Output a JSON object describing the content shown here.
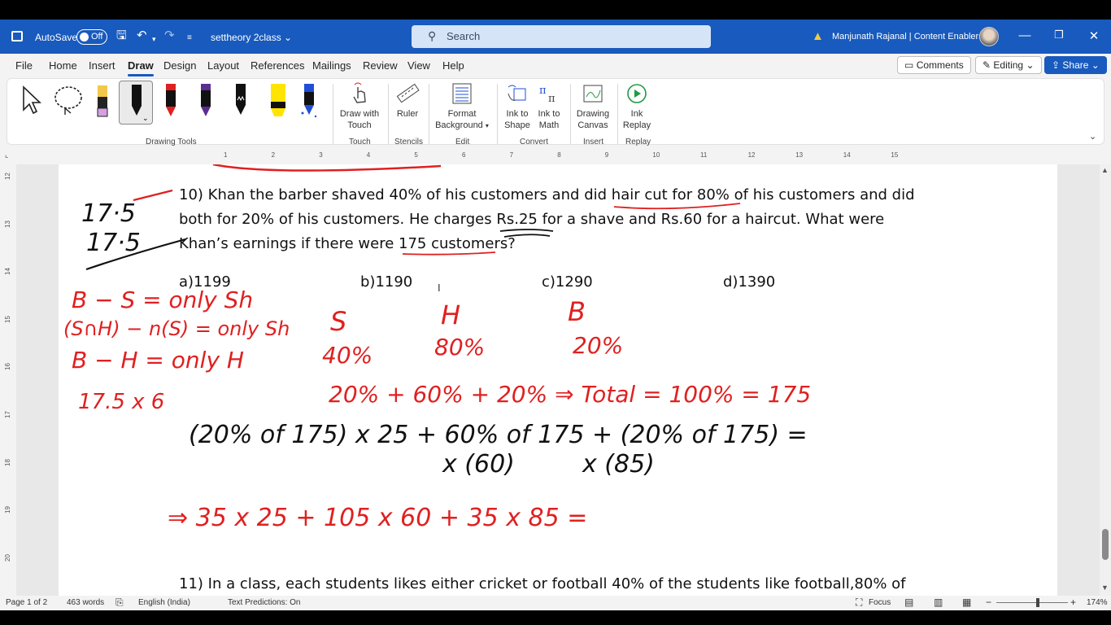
{
  "titlebar": {
    "autosave_label": "AutoSave",
    "autosave_state": "Off",
    "doc_name": "settheory 2class",
    "search_placeholder": "Search",
    "user_name": "Manjunath Rajanal | Content Enablers"
  },
  "menu": {
    "tabs": [
      "File",
      "Home",
      "Insert",
      "Draw",
      "Design",
      "Layout",
      "References",
      "Mailings",
      "Review",
      "View",
      "Help"
    ],
    "active_tab": "Draw",
    "comments_label": "Comments",
    "editing_label": "Editing",
    "share_label": "Share"
  },
  "ribbon": {
    "groups": {
      "drawing_tools": "Drawing Tools",
      "touch": "Touch",
      "stencils": "Stencils",
      "edit": "Edit",
      "convert": "Convert",
      "insert": "Insert",
      "replay": "Replay"
    },
    "draw_with_touch_1": "Draw with",
    "draw_with_touch_2": "Touch",
    "ruler": "Ruler",
    "format_background_1": "Format",
    "format_background_2": "Background",
    "ink_to_shape_1": "Ink to",
    "ink_to_shape_2": "Shape",
    "ink_to_math_1": "Ink to",
    "ink_to_math_2": "Math",
    "drawing_canvas_1": "Drawing",
    "drawing_canvas_2": "Canvas",
    "ink_replay_1": "Ink",
    "ink_replay_2": "Replay",
    "pen_colors": [
      "#000000",
      "#e02020",
      "#5a2d91",
      "#000000",
      "#ffe400",
      "#1f4fd6"
    ]
  },
  "ruler": {
    "h_numbers": [
      "1",
      "2",
      "3",
      "4",
      "5",
      "6",
      "7",
      "8",
      "9",
      "10",
      "11",
      "12",
      "13",
      "14",
      "15"
    ],
    "v_numbers": [
      "12",
      "13",
      "14",
      "15",
      "16",
      "17",
      "18",
      "19",
      "20"
    ]
  },
  "document": {
    "q10_line1": "10) Khan the barber shaved 40% of his customers and did hair cut for 80% of his customers and did",
    "q10_line2": "both for 20% of his customers. He charges Rs.25 for a shave and Rs.60 for a haircut. What were",
    "q10_line3": "Khan’s earnings if there were 175 customers?",
    "options": [
      "a)1199",
      "b)1190",
      "c)1290",
      "d)1390"
    ],
    "q11_line1": "11) In a class, each students likes either cricket or football 40% of the students like football,80% of"
  },
  "ink": {
    "notes": [
      "17·5",
      "17·5",
      "B − S = only Sh",
      "(S∩H) − n(S) = only Sh",
      "B − H = only H",
      "17.5 x 6"
    ],
    "row1": [
      "S",
      "H",
      "B"
    ],
    "row2": [
      "40%",
      "80%",
      "20%"
    ],
    "row3": "20%  +  60%  +  20%  ⇒ Total = 100% = 175",
    "expr1": "(20% of 175) x 25  + 60% of 175  + (20% of 175)  =",
    "expr2a": "x (60)",
    "expr2b": "x (85)",
    "expr3": "⇒  35 x 25     + 105 x 60   +  35 x 85  ="
  },
  "status": {
    "page": "Page 1 of 2",
    "words": "463 words",
    "language": "English (India)",
    "text_predictions": "Text Predictions: On",
    "focus": "Focus",
    "zoom": "174%"
  }
}
